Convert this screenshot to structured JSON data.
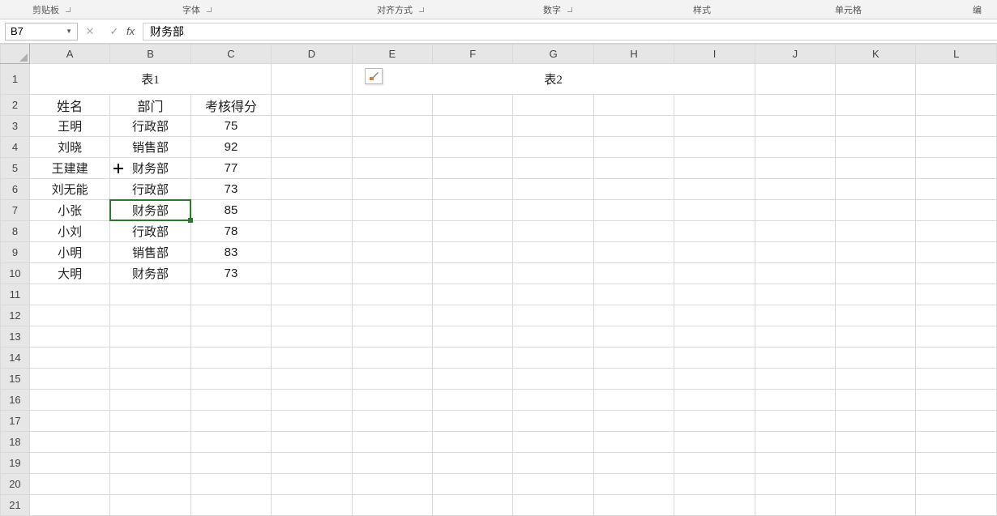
{
  "ribbon": {
    "groups": [
      "剪贴板",
      "字体",
      "对齐方式",
      "数字",
      "样式",
      "单元格",
      "编"
    ]
  },
  "namebox": "B7",
  "formula": "财务部",
  "columns": [
    "A",
    "B",
    "C",
    "D",
    "E",
    "F",
    "G",
    "H",
    "I",
    "J",
    "K",
    "L"
  ],
  "rows": [
    "1",
    "2",
    "3",
    "4",
    "5",
    "6",
    "7",
    "8",
    "9",
    "10",
    "11",
    "12",
    "13",
    "14",
    "15",
    "16",
    "17",
    "18",
    "19",
    "20",
    "21"
  ],
  "titles": {
    "t1": "表1",
    "t2": "表2"
  },
  "table1": {
    "headers": [
      "姓名",
      "部门",
      "考核得分"
    ],
    "rows": [
      [
        "王明",
        "行政部",
        "75"
      ],
      [
        "刘晓",
        "销售部",
        "92"
      ],
      [
        "王建建",
        "财务部",
        "77"
      ],
      [
        "刘无能",
        "行政部",
        "73"
      ],
      [
        "小张",
        "财务部",
        "85"
      ],
      [
        "小刘",
        "行政部",
        "78"
      ],
      [
        "小明",
        "销售部",
        "83"
      ],
      [
        "大明",
        "财务部",
        "73"
      ]
    ]
  },
  "active_cell": "B7",
  "selected_col": "B",
  "selected_row": "7"
}
